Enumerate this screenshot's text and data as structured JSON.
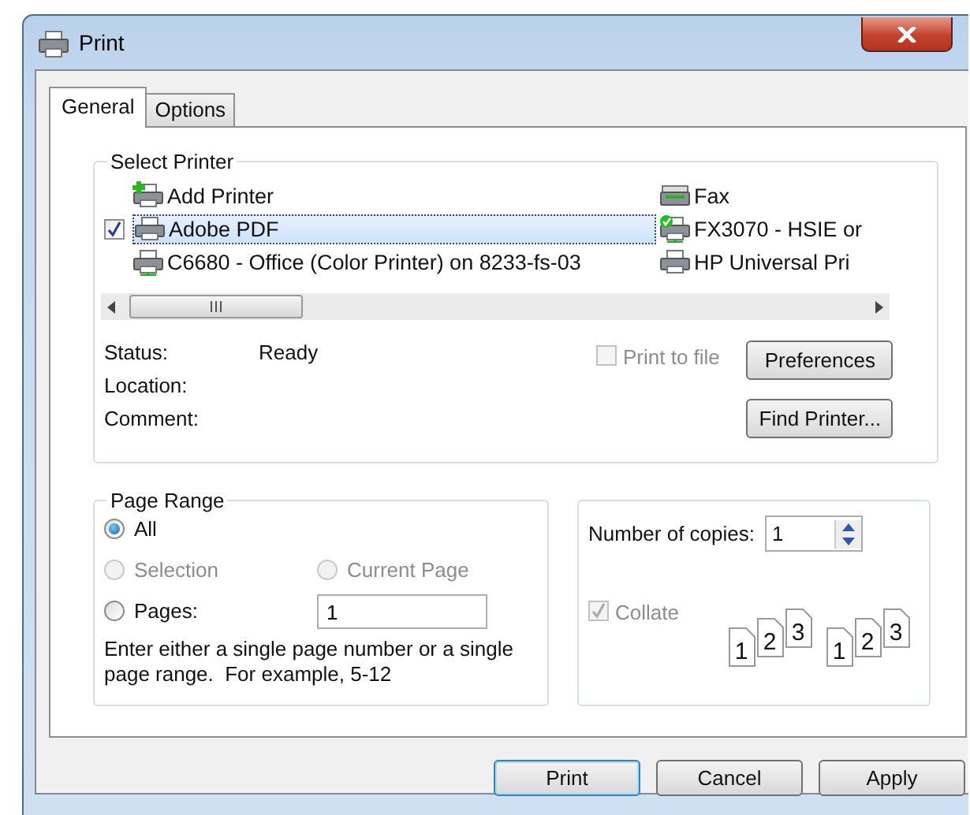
{
  "window": {
    "title": "Print"
  },
  "tabs": [
    {
      "label": "General",
      "selected": true
    },
    {
      "label": "Options",
      "selected": false
    }
  ],
  "select_printer": {
    "title": "Select Printer",
    "columns": [
      [
        {
          "name": "Add Printer",
          "kind": "add",
          "selected": false
        },
        {
          "name": "Adobe PDF",
          "kind": "printer",
          "selected": true
        },
        {
          "name": "C6680 - Office (Color Printer) on 8233-fs-03",
          "kind": "network",
          "selected": false
        }
      ],
      [
        {
          "name": "Fax",
          "kind": "fax",
          "selected": false
        },
        {
          "name": "FX3070 - HSIE or",
          "kind": "default",
          "selected": false
        },
        {
          "name": "HP Universal Pri",
          "kind": "printer",
          "selected": false
        }
      ]
    ],
    "info": [
      {
        "label": "Status:",
        "value": "Ready"
      },
      {
        "label": "Location:"
      },
      {
        "label": "Comment:"
      }
    ],
    "print_to_file": {
      "label": "Print to file",
      "checked": false,
      "disabled": true
    },
    "buttons": [
      "Preferences",
      "Find Printer..."
    ]
  },
  "page_range": {
    "title": "Page Range",
    "options": [
      {
        "label": "All",
        "selected": true,
        "disabled": false
      },
      {
        "label": "Selection",
        "selected": false,
        "disabled": true
      },
      {
        "label": "Current Page",
        "selected": false,
        "disabled": true
      },
      {
        "label": "Pages:",
        "selected": false,
        "disabled": false
      }
    ],
    "pages_value": "1",
    "hint": "Enter either a single page number or a single page range.  For example, 5-12"
  },
  "copies": {
    "label": "Number of copies:",
    "value": "1",
    "collate": {
      "label": "Collate",
      "checked": true,
      "disabled": true
    },
    "stacks": [
      [
        "1",
        "2",
        "3"
      ],
      [
        "1",
        "2",
        "3"
      ]
    ]
  },
  "buttons": [
    "Print",
    "Cancel",
    "Apply"
  ]
}
